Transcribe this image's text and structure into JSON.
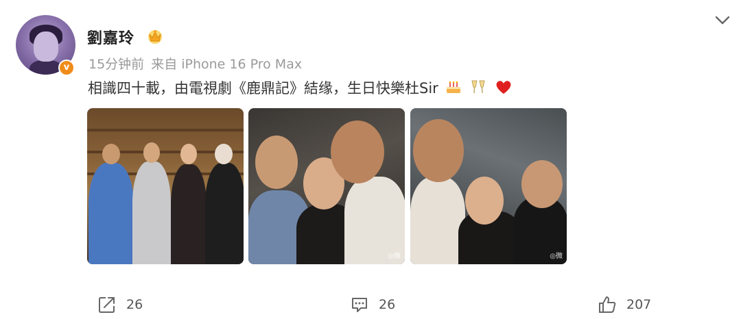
{
  "post": {
    "username": "劉嘉玲",
    "time": "15分钟前",
    "source": "来自 iPhone 16 Pro Max",
    "text": "相識四十載，由電視劇《鹿鼎記》結缘，生日快樂杜Sir",
    "verified_mark": "v"
  },
  "photos": {
    "watermark": "◎微"
  },
  "actions": {
    "share_count": "26",
    "comment_count": "26",
    "like_count": "207"
  },
  "icons": [
    "crown-badge-icon",
    "chevron-down-icon",
    "cake-icon",
    "cheers-icon",
    "heart-icon",
    "share-icon",
    "comment-icon",
    "like-icon"
  ],
  "colors": {
    "verified": "#f08c1a",
    "heart": "#e02020",
    "crown": "#f3a521",
    "meta": "#9a9a9a"
  }
}
